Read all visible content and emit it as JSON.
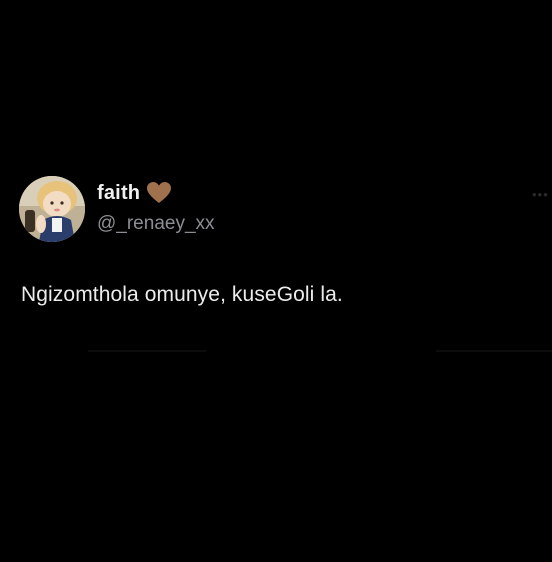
{
  "tweet": {
    "display_name": "faith",
    "handle": "@_renaey_xx",
    "text": "Ngizomthola omunye, kuseGoli la.",
    "badge_icon": "heart-icon",
    "badge_color": "#a0714d",
    "more_icon": "more-options-icon"
  },
  "theme": {
    "background": "#000000",
    "text_primary": "#ececec",
    "text_secondary": "#8b8f94"
  }
}
